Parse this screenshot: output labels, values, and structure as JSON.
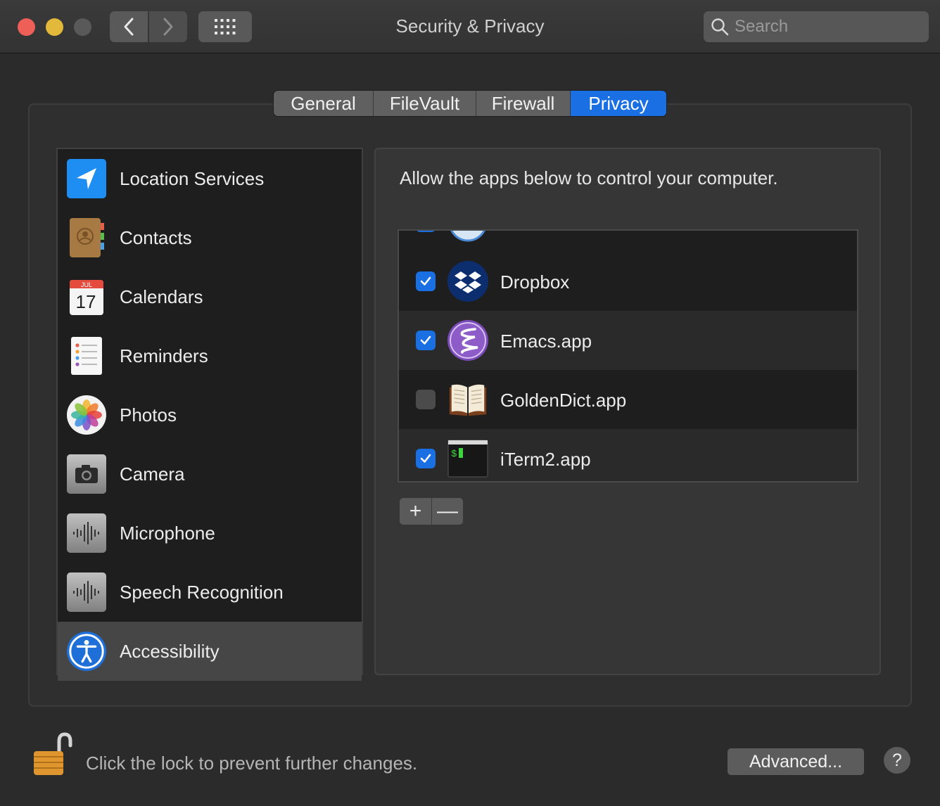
{
  "window": {
    "title": "Security & Privacy"
  },
  "search": {
    "placeholder": "Search"
  },
  "tabs": [
    {
      "label": "General"
    },
    {
      "label": "FileVault"
    },
    {
      "label": "Firewall"
    },
    {
      "label": "Privacy"
    }
  ],
  "sidebar": {
    "items": [
      {
        "label": "Location Services",
        "icon": "location-arrow-icon"
      },
      {
        "label": "Contacts",
        "icon": "contacts-book-icon"
      },
      {
        "label": "Calendars",
        "icon": "calendar-icon"
      },
      {
        "label": "Reminders",
        "icon": "reminders-list-icon"
      },
      {
        "label": "Photos",
        "icon": "photos-flower-icon"
      },
      {
        "label": "Camera",
        "icon": "camera-icon"
      },
      {
        "label": "Microphone",
        "icon": "waveform-icon"
      },
      {
        "label": "Speech Recognition",
        "icon": "waveform-icon"
      },
      {
        "label": "Accessibility",
        "icon": "accessibility-icon"
      }
    ],
    "selected": "Accessibility"
  },
  "calendar_icon": {
    "month": "JUL",
    "day": "17"
  },
  "panel": {
    "description": "Allow the apps below to control your computer.",
    "apps": [
      {
        "name": "Dropbox",
        "checked": true,
        "icon": "dropbox-icon"
      },
      {
        "name": "Emacs.app",
        "checked": true,
        "icon": "emacs-icon"
      },
      {
        "name": "GoldenDict.app",
        "checked": false,
        "icon": "book-icon"
      },
      {
        "name": "iTerm2.app",
        "checked": true,
        "icon": "terminal-icon"
      }
    ],
    "terminal_prompt": "$",
    "add_label": "+",
    "remove_label": "—"
  },
  "footer": {
    "lock_text": "Click the lock to prevent further changes.",
    "advanced_label": "Advanced...",
    "help_label": "?"
  },
  "colors": {
    "accent": "#1a6fe3",
    "close": "#ed5f57",
    "minimize": "#e3b93b"
  }
}
